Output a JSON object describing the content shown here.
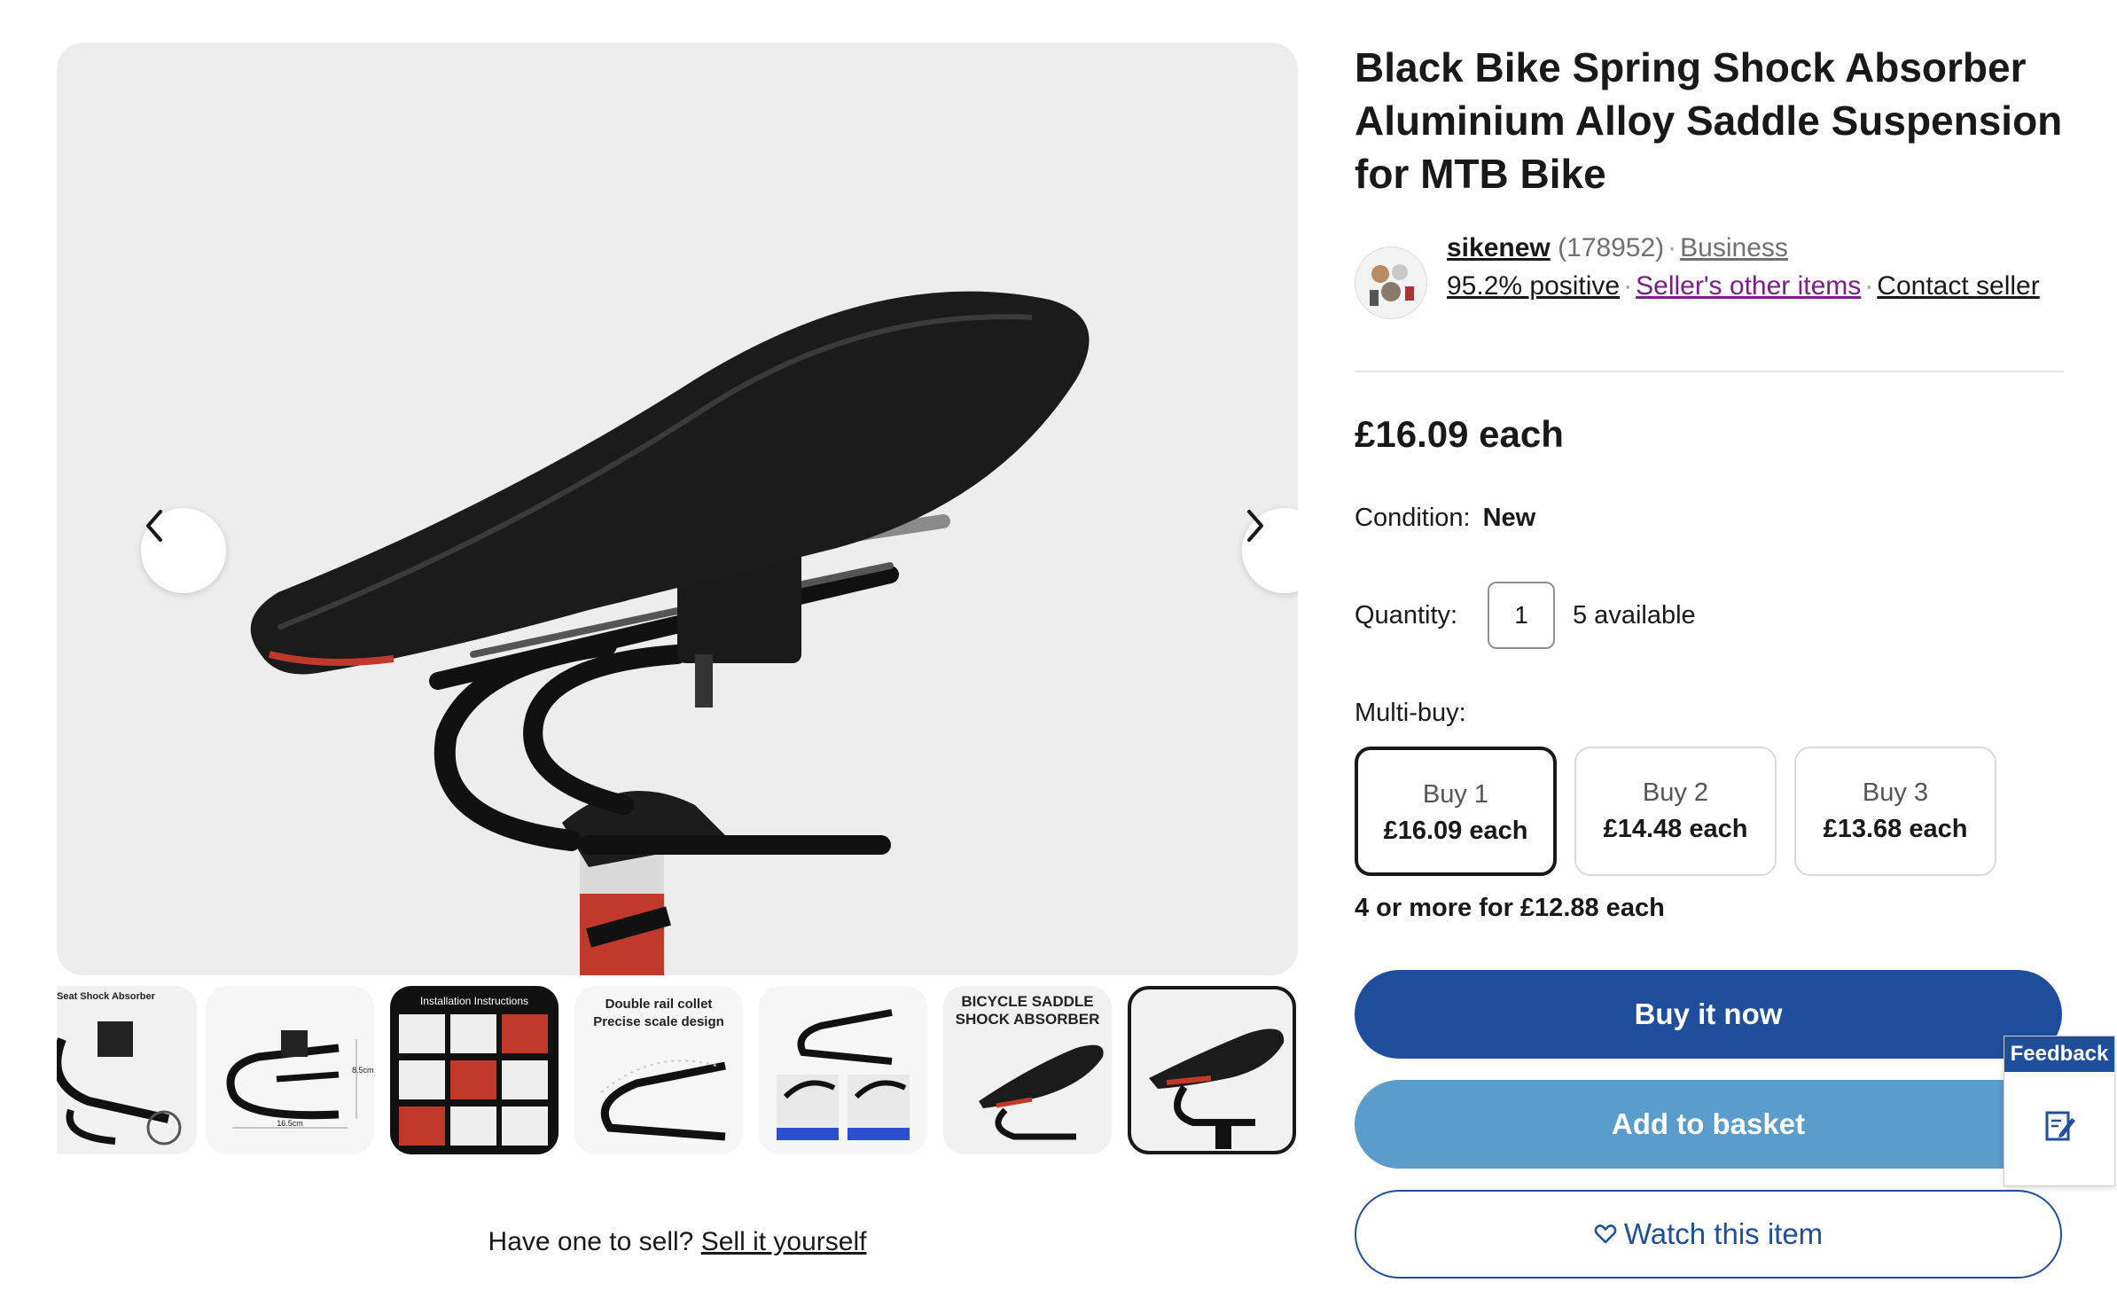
{
  "product": {
    "title": "Black Bike Spring Shock Absorber Aluminium Alloy Saddle Suspension for MTB Bike"
  },
  "seller": {
    "name": "sikenew",
    "feedback_count": "(178952)",
    "type": "Business",
    "positive": "95.2% positive",
    "other_items": "Seller's other items",
    "contact": "Contact seller",
    "avatar_icon": "seller-logo-icon"
  },
  "price": {
    "main": "£16.09 each"
  },
  "condition": {
    "label": "Condition:",
    "value": "New"
  },
  "quantity": {
    "label": "Quantity:",
    "value": "1",
    "available": "5 available"
  },
  "multibuy": {
    "label": "Multi-buy:",
    "options": [
      {
        "qty": "Buy 1",
        "price": "£16.09 each",
        "selected": true
      },
      {
        "qty": "Buy 2",
        "price": "£14.48 each",
        "selected": false
      },
      {
        "qty": "Buy 3",
        "price": "£13.68 each",
        "selected": false
      }
    ],
    "note": "4 or more for £12.88 each"
  },
  "actions": {
    "buy_now": "Buy it now",
    "add_to_basket": "Add to basket",
    "watch": "Watch this item"
  },
  "gallery": {
    "prev_icon": "chevron-left-icon",
    "next_icon": "chevron-right-icon",
    "thumbnails": [
      {
        "caption": "Seat Shock Absorber"
      },
      {
        "caption_w": "16.5cm",
        "caption_h": "8.5cm"
      },
      {
        "caption": "Installation Instructions"
      },
      {
        "caption": "Double rail collet",
        "caption2": "Precise scale design"
      },
      {
        "caption": ""
      },
      {
        "caption": "BICYCLE SADDLE",
        "caption2": "SHOCK ABSORBER"
      },
      {
        "caption": ""
      }
    ]
  },
  "sell": {
    "prompt": "Have one to sell?",
    "link": "Sell it yourself"
  },
  "feedback": {
    "label": "Feedback"
  },
  "colors": {
    "primary_blue": "#1f4f9c",
    "light_blue": "#5a9ccc",
    "purple_link": "#7b1e8a",
    "gallery_bg": "#ededed"
  }
}
